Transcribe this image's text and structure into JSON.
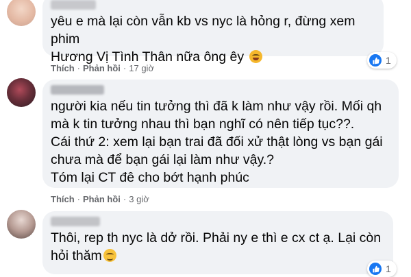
{
  "colors": {
    "bubble": "#f0f2f5",
    "text": "#050505",
    "meta": "#65676b",
    "like": "#1877f2"
  },
  "comments": [
    {
      "lines": [
        "yêu e mà lại còn vẫn kb vs nyc là hỏng r, đừng xem phim",
        "Hương Vị Tình Thân nữa ông êy"
      ],
      "emoji": "rolling-on-floor-laughing-emoji",
      "like_label": "Thích",
      "reply_label": "Phản hồi",
      "time": "17 giờ",
      "reaction_icon": "like-icon",
      "reaction_count": "1"
    },
    {
      "lines": [
        "người kia nếu tin tưởng thì đã k làm như vậy rồi. Mối qh",
        "mà k tin tưởng nhau thì bạn nghĩ có nên tiếp tục??.",
        "Cái thứ 2: xem lại bạn trai đã đối xử thật lòng vs bạn gái",
        "chưa mà để bạn gái lại làm như vậy.?",
        "Tóm lại CT đê cho bớt hạnh phúc"
      ],
      "like_label": "Thích",
      "reply_label": "Phản hồi",
      "time": "3 giờ"
    },
    {
      "lines": [
        "Thôi, rep th nyc là dở rồi. Phải ny e thì e cx ct ạ. Lại còn",
        "hỏi thăm"
      ],
      "emoji": "relieved-face-emoji",
      "reaction_icon": "like-icon",
      "reaction_count": "1"
    }
  ]
}
